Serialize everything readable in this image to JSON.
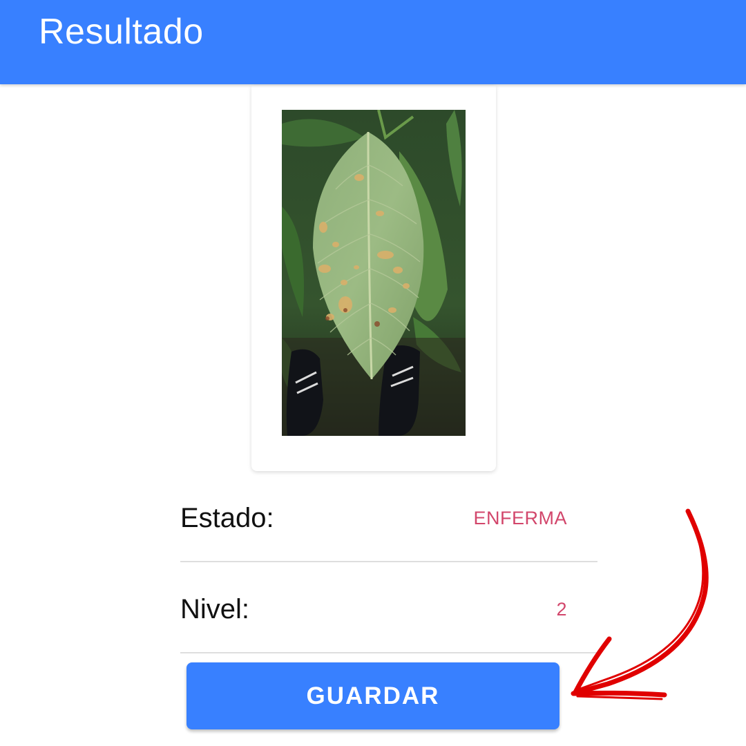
{
  "toolbar": {
    "title": "Resultado",
    "color": "#3880ff"
  },
  "image_card": {
    "photo_subject": "leaf-photo"
  },
  "result": {
    "estado": {
      "label": "Estado:",
      "value": "ENFERMA"
    },
    "nivel": {
      "label": "Nivel:",
      "value": "2"
    },
    "value_color": "#d2466b"
  },
  "actions": {
    "save_label": "GUARDAR"
  },
  "annotation": {
    "type": "arrow-icon",
    "color": "#e00000"
  }
}
